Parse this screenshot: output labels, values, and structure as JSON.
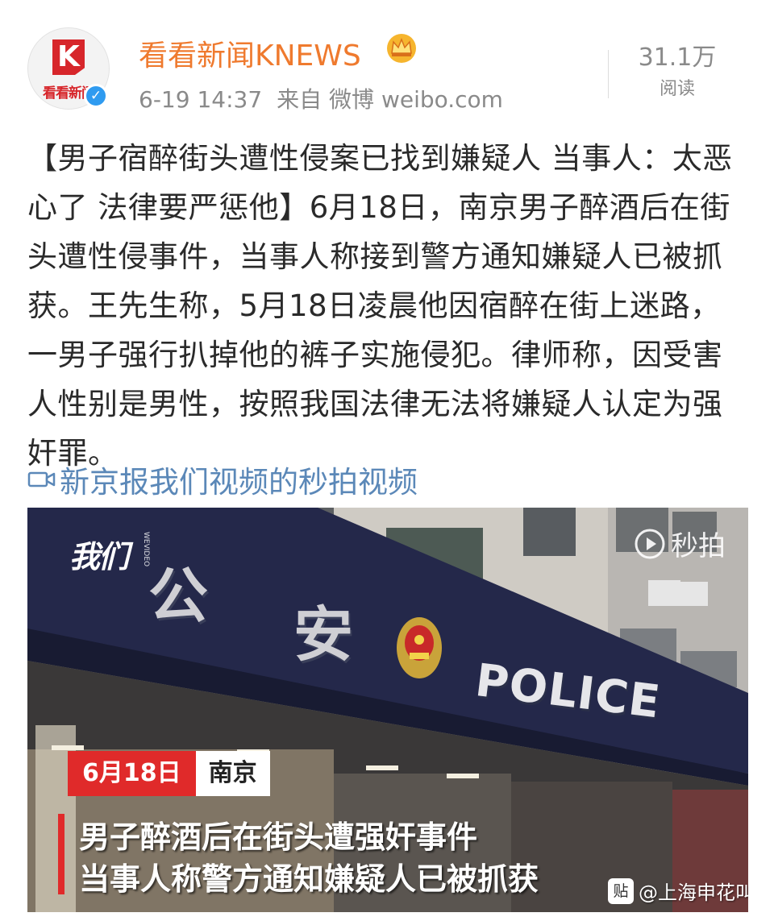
{
  "post": {
    "author": "看看新闻KNEWS",
    "avatar_text": "看看新闻",
    "avatar_letter": "K",
    "time": "6-19 14:37",
    "source": "来自 微博 weibo.com",
    "read_count": "31.1万",
    "read_label": "阅读",
    "text": "【男子宿醉街头遭性侵案已找到嫌疑人 当事人：太恶心了 法律要严惩他】6月18日，南京男子醉酒后在街头遭性侵事件，当事人称接到警方通知嫌疑人已被抓获。王先生称，5月18日凌晨他因宿醉在街上迷路，一男子强行扒掉他的裤子实施侵犯。律师称，因受害人性别是男性，按照我国法律无法将嫌疑人认定为强奸罪。",
    "video_link": "新京报我们视频的秒拍视频"
  },
  "video": {
    "brand": "我们",
    "brand_side": "WEVIDEO",
    "miaopai": "秒拍",
    "sign_chars": [
      "公",
      "安"
    ],
    "police_text": "POLICE",
    "date": "6月18日",
    "city": "南京",
    "caption_line1": "男子醉酒后在街头遭强奸事件",
    "caption_line2": "当事人称警方通知嫌疑人已被抓获",
    "watermark_icon": "贴",
    "watermark": "@上海申花叫"
  },
  "colors": {
    "username": "#ef7a2e",
    "link": "#5b88b8",
    "meta": "#8a8a8a",
    "badge_red": "#e02a2a",
    "verified": "#2f9bf0"
  },
  "icons": [
    "verified-badge-icon",
    "crown-icon",
    "video-camera-icon",
    "miaopai-logo-icon",
    "police-emblem-icon",
    "tieba-icon"
  ]
}
